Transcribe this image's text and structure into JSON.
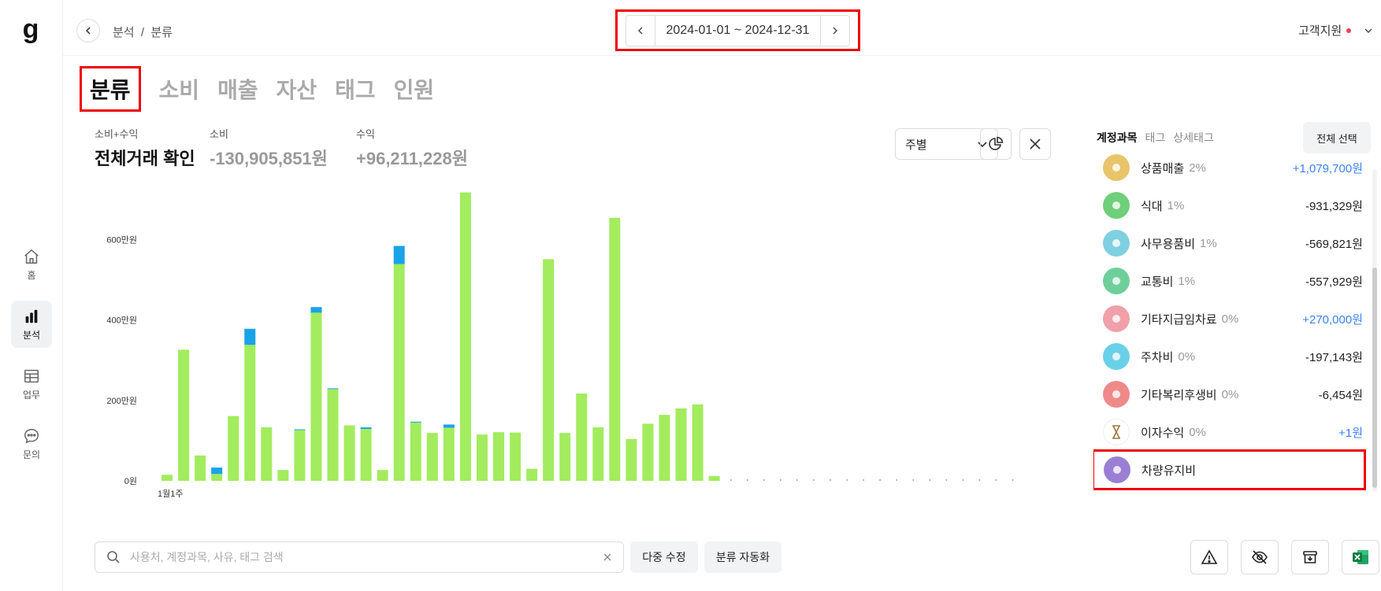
{
  "nav": {
    "logo": "g",
    "items": [
      {
        "label": "홈",
        "icon": "home-icon"
      },
      {
        "label": "분석",
        "icon": "bar-chart-icon"
      },
      {
        "label": "업무",
        "icon": "table-icon"
      },
      {
        "label": "문의",
        "icon": "chat-icon"
      }
    ]
  },
  "header": {
    "breadcrumb": "분석  /  분류",
    "date_range": "2024-01-01 ~ 2024-12-31",
    "support": "고객지원"
  },
  "tabs": [
    "분류",
    "소비",
    "매출",
    "자산",
    "태그",
    "인원"
  ],
  "summary": {
    "all_label": "소비+수익",
    "all_value": "전체거래 확인",
    "spend_label": "소비",
    "spend_value": "-130,905,851원",
    "income_label": "수익",
    "income_value": "+96,211,228원"
  },
  "controls": {
    "period": "주별"
  },
  "category_panel": {
    "tabs": [
      "계정과목",
      "태그",
      "상세태그"
    ],
    "select_all": "전체 선택",
    "items": [
      {
        "name": "상품매출",
        "pct": "2%",
        "amount": "+1,079,700원",
        "positive": true,
        "color": "#e8c56a",
        "icon": "shopping-bag-icon"
      },
      {
        "name": "식대",
        "pct": "1%",
        "amount": "-931,329원",
        "positive": false,
        "color": "#6fcf7a",
        "icon": "bowl-icon"
      },
      {
        "name": "사무용품비",
        "pct": "1%",
        "amount": "-569,821원",
        "positive": false,
        "color": "#7fd0e0",
        "icon": "pen-icon"
      },
      {
        "name": "교통비",
        "pct": "1%",
        "amount": "-557,929원",
        "positive": false,
        "color": "#6fcf9a",
        "icon": "train-icon"
      },
      {
        "name": "기타지급임차료",
        "pct": "0%",
        "amount": "+270,000원",
        "positive": true,
        "color": "#f0a0a8",
        "icon": "building-icon"
      },
      {
        "name": "주차비",
        "pct": "0%",
        "amount": "-197,143원",
        "positive": false,
        "color": "#6ad0e8",
        "icon": "parking-icon"
      },
      {
        "name": "기타복리후생비",
        "pct": "0%",
        "amount": "-6,454원",
        "positive": false,
        "color": "#f08a8a",
        "icon": "dish-icon"
      },
      {
        "name": "이자수익",
        "pct": "0%",
        "amount": "+1원",
        "positive": true,
        "color": "#ffffff",
        "icon": "hourglass-icon"
      },
      {
        "name": "차량유지비",
        "pct": "",
        "amount": "",
        "positive": false,
        "color": "#9b7fd4",
        "icon": "fuel-icon"
      }
    ]
  },
  "search": {
    "placeholder": "사용처, 계정과목, 사유, 태그 검색"
  },
  "buttons": {
    "multi_edit": "다중 수정",
    "auto_classify": "분류 자동화"
  },
  "chart_data": {
    "type": "bar",
    "stacked": true,
    "y_ticks": [
      "0원",
      "200만원",
      "400만원",
      "600만원"
    ],
    "ylim": [
      0,
      7200000
    ],
    "x_tick_label": "1월1주",
    "grid": false,
    "series": [
      {
        "color": "#a2ec5e",
        "values": [
          150000,
          3260000,
          630000,
          170000,
          1610000,
          3380000,
          1330000,
          270000,
          1260000,
          4180000,
          2280000,
          1380000,
          1290000,
          270000,
          5390000,
          1450000,
          1190000,
          1320000,
          7170000,
          1150000,
          1210000,
          1200000,
          300000,
          5510000,
          1190000,
          2170000,
          1330000,
          6540000,
          1040000,
          1420000,
          1640000,
          1800000,
          1900000,
          120000,
          0,
          0,
          0,
          0,
          0,
          0,
          0,
          0,
          0,
          0,
          0,
          0,
          0,
          0,
          0,
          0,
          0,
          0
        ]
      },
      {
        "color": "#1ba3e8",
        "values": [
          0,
          0,
          0,
          160000,
          0,
          400000,
          0,
          0,
          20000,
          140000,
          20000,
          0,
          40000,
          0,
          450000,
          20000,
          0,
          80000,
          0,
          0,
          0,
          0,
          0,
          0,
          0,
          0,
          0,
          0,
          0,
          0,
          0,
          0,
          0,
          0,
          0,
          0,
          0,
          0,
          0,
          0,
          0,
          0,
          0,
          0,
          0,
          0,
          0,
          0,
          0,
          0,
          0,
          0
        ]
      }
    ]
  }
}
